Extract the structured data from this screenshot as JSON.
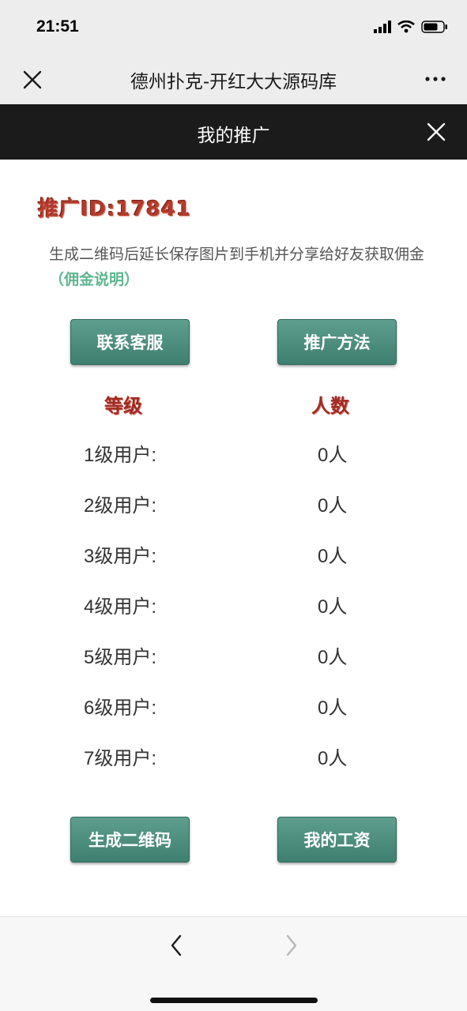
{
  "status": {
    "time": "21:51"
  },
  "nav": {
    "title": "德州扑克-开红大大源码库"
  },
  "header": {
    "title": "我的推广"
  },
  "promo": {
    "id_label": "推广ID:",
    "id_value": "17841",
    "description": "生成二维码后延长保存图片到手机并分享给好友获取佣金",
    "commission_link": "（佣金说明）"
  },
  "buttons": {
    "contact": "联系客服",
    "method": "推广方法",
    "qrcode": "生成二维码",
    "salary": "我的工资"
  },
  "table": {
    "headers": {
      "level": "等级",
      "count": "人数"
    },
    "rows": [
      {
        "label": "1级用户:",
        "count": "0人"
      },
      {
        "label": "2级用户:",
        "count": "0人"
      },
      {
        "label": "3级用户:",
        "count": "0人"
      },
      {
        "label": "4级用户:",
        "count": "0人"
      },
      {
        "label": "5级用户:",
        "count": "0人"
      },
      {
        "label": "6级用户:",
        "count": "0人"
      },
      {
        "label": "7级用户:",
        "count": "0人"
      }
    ]
  }
}
